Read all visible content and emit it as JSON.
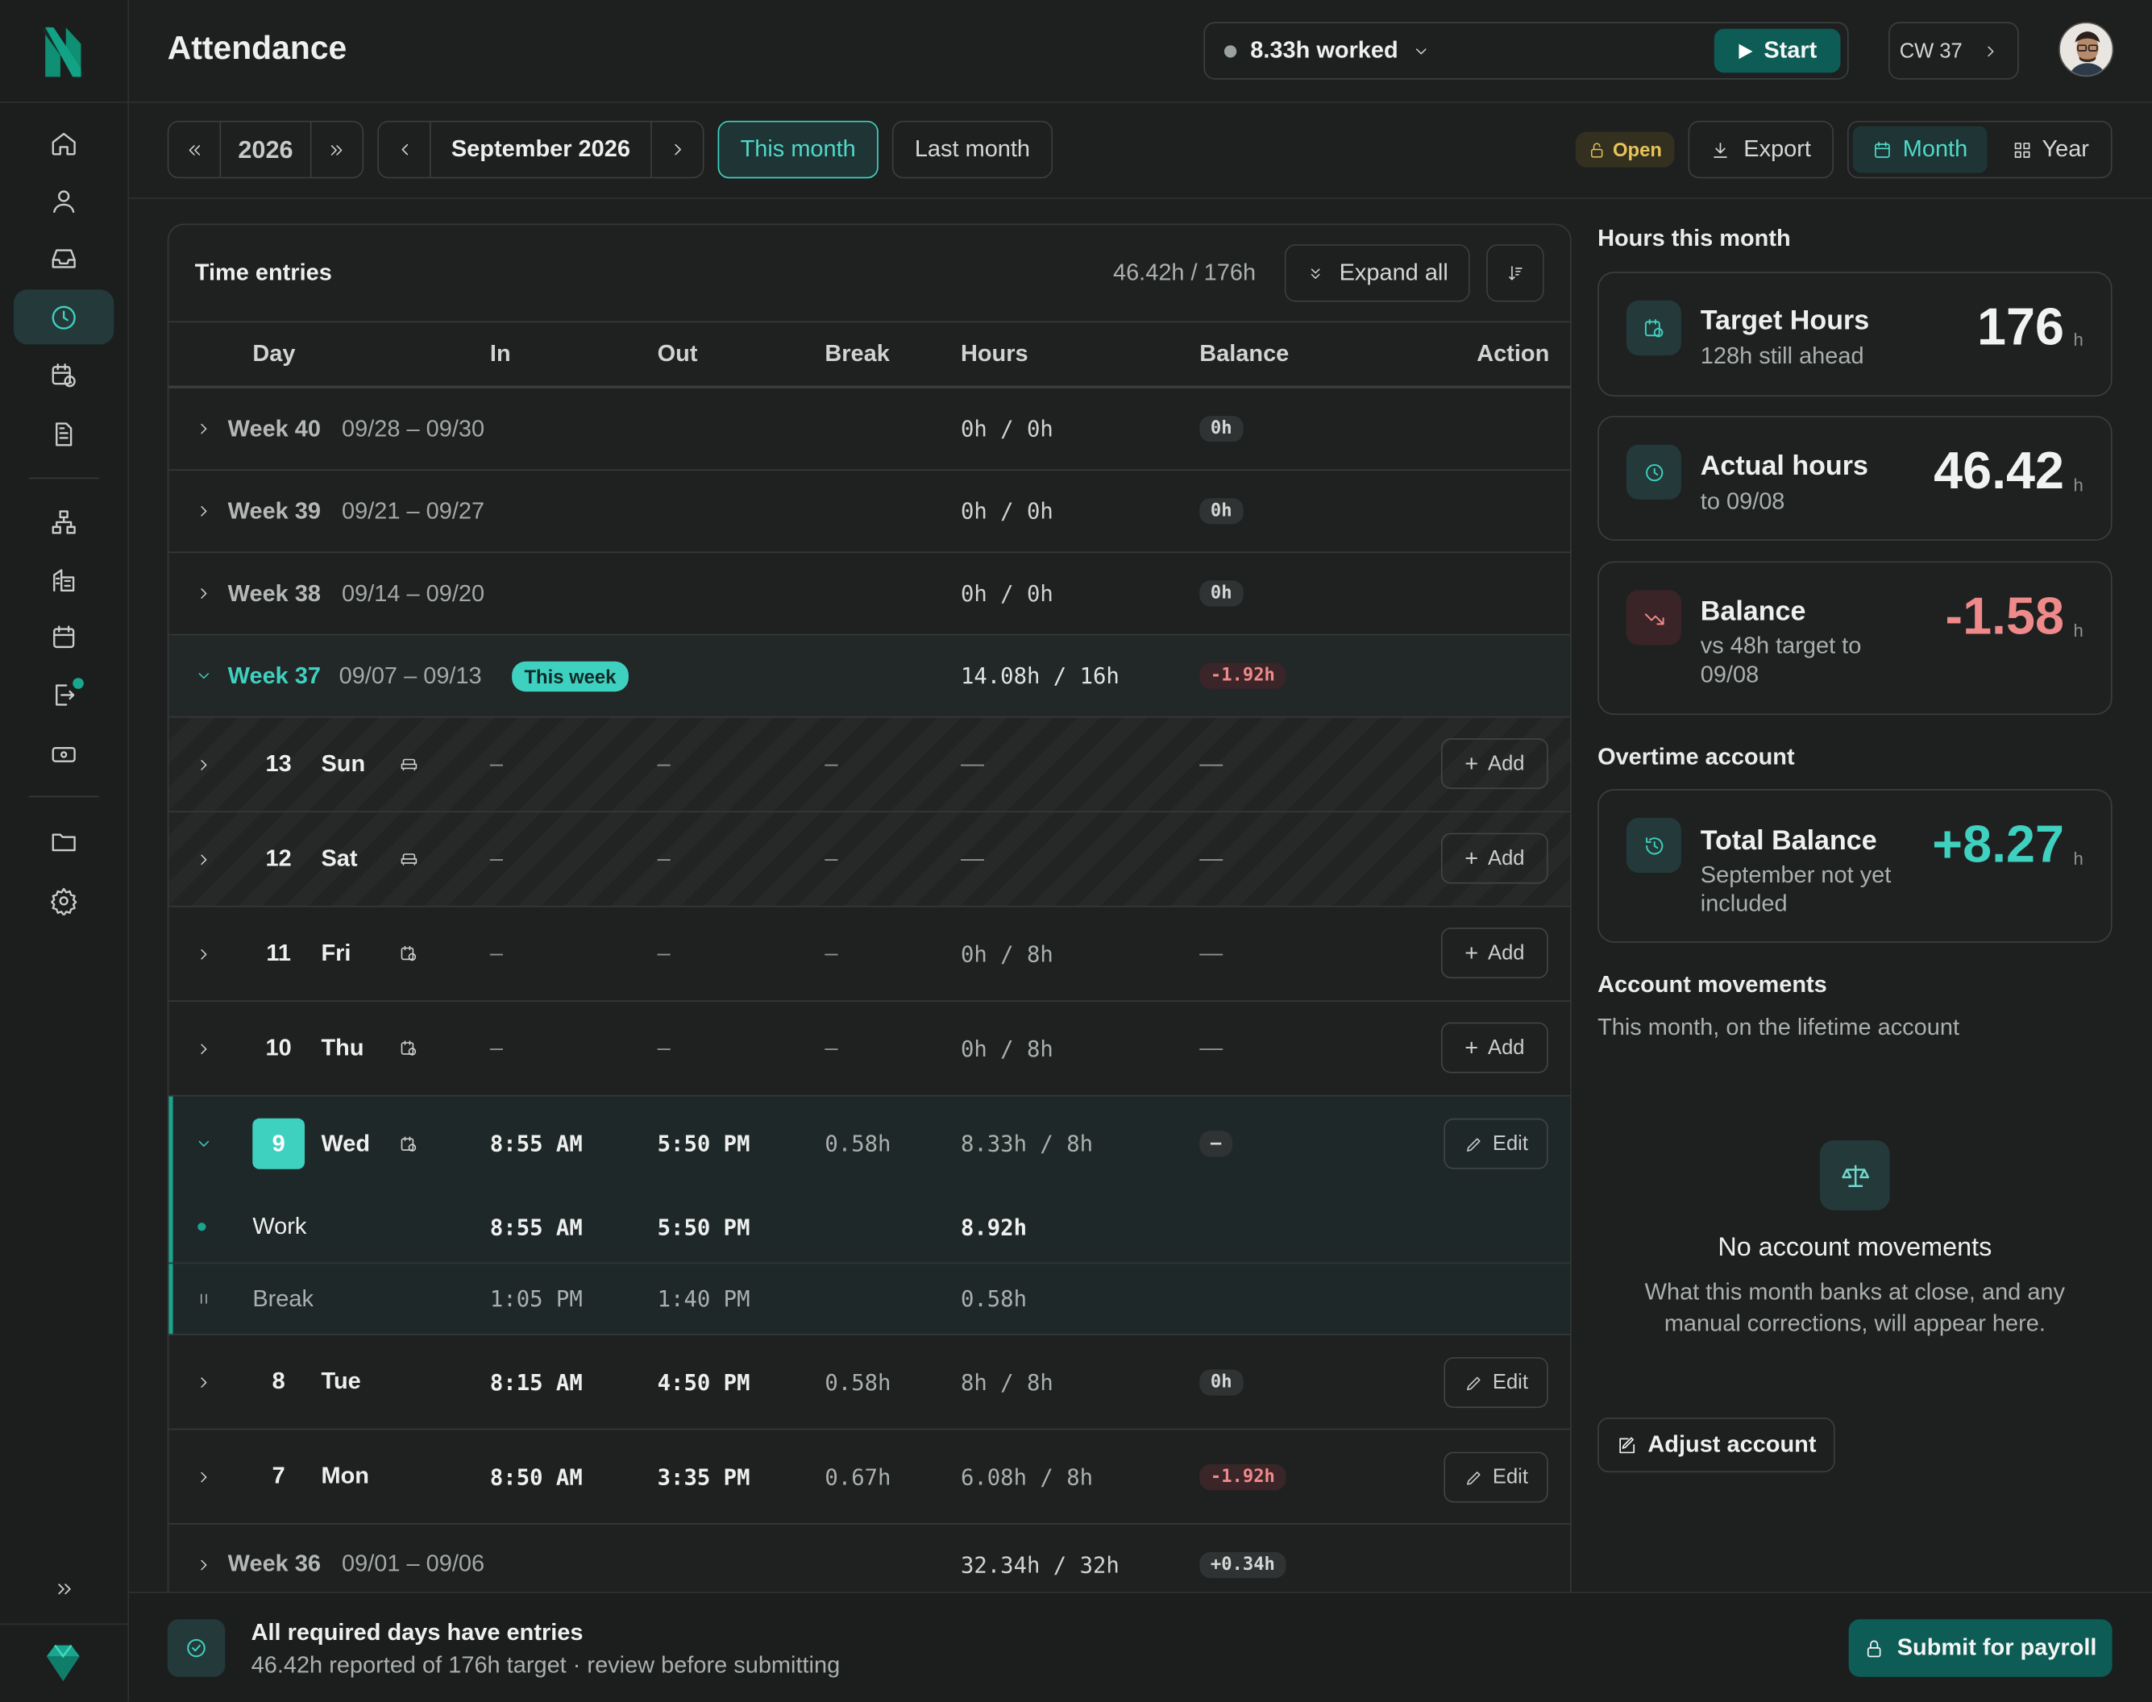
{
  "header": {
    "title": "Attendance",
    "worked": "8.33h worked",
    "start": "Start",
    "cw": "CW 37"
  },
  "toolbar": {
    "year": "2026",
    "month": "September 2026",
    "this_month": "This month",
    "last_month": "Last month",
    "status": "Open",
    "export": "Export",
    "view_month": "Month",
    "view_year": "Year"
  },
  "table": {
    "title": "Time entries",
    "total": "46.42h / 176h",
    "expand": "Expand all",
    "columns": [
      "Day",
      "In",
      "Out",
      "Break",
      "Hours",
      "Balance",
      "Action"
    ],
    "weeks": [
      {
        "label": "Week 40",
        "range": "09/28 – 09/30",
        "hours": "0h / 0h",
        "balance": "0h"
      },
      {
        "label": "Week 39",
        "range": "09/21 – 09/27",
        "hours": "0h / 0h",
        "balance": "0h"
      },
      {
        "label": "Week 38",
        "range": "09/14 – 09/20",
        "hours": "0h / 0h",
        "balance": "0h"
      },
      {
        "label": "Week 37",
        "range": "09/07 – 09/13",
        "tag": "This week",
        "hours": "14.08h / 16h",
        "balance": "-1.92h"
      },
      {
        "label": "Week 36",
        "range": "09/01 – 09/06",
        "hours": "32.34h / 32h",
        "balance": "+0.34h"
      }
    ],
    "days": [
      {
        "num": "13",
        "name": "Sun",
        "in": "–",
        "out": "–",
        "brk": "–",
        "hours": "—",
        "balance": "—",
        "action": "Add"
      },
      {
        "num": "12",
        "name": "Sat",
        "in": "–",
        "out": "–",
        "brk": "–",
        "hours": "—",
        "balance": "—",
        "action": "Add"
      },
      {
        "num": "11",
        "name": "Fri",
        "in": "–",
        "out": "–",
        "brk": "–",
        "hours": "0h / 8h",
        "balance": "—",
        "action": "Add"
      },
      {
        "num": "10",
        "name": "Thu",
        "in": "–",
        "out": "–",
        "brk": "–",
        "hours": "0h / 8h",
        "balance": "—",
        "action": "Add"
      },
      {
        "num": "9",
        "name": "Wed",
        "in": "8:55 AM",
        "out": "5:50 PM",
        "brk": "0.58h",
        "hours": "8.33h / 8h",
        "balance": "–",
        "action": "Edit"
      },
      {
        "num": "8",
        "name": "Tue",
        "in": "8:15 AM",
        "out": "4:50 PM",
        "brk": "0.58h",
        "hours": "8h / 8h",
        "balance": "0h",
        "action": "Edit"
      },
      {
        "num": "7",
        "name": "Mon",
        "in": "8:50 AM",
        "out": "3:35 PM",
        "brk": "0.67h",
        "hours": "6.08h / 8h",
        "balance": "-1.92h",
        "action": "Edit"
      }
    ],
    "segments": [
      {
        "label": "Work",
        "in": "8:55 AM",
        "out": "5:50 PM",
        "hours": "8.92h"
      },
      {
        "label": "Break",
        "in": "1:05 PM",
        "out": "1:40 PM",
        "hours": "0.58h"
      }
    ]
  },
  "summary": {
    "section": "Hours this month",
    "target": {
      "title": "Target Hours",
      "sub": "128h still ahead",
      "value": "176",
      "unit": "h"
    },
    "actual": {
      "title": "Actual hours",
      "sub": "to 09/08",
      "value": "46.42",
      "unit": "h"
    },
    "balance": {
      "title": "Balance",
      "sub": "vs 48h target to 09/08",
      "value": "-1.58",
      "unit": "h"
    }
  },
  "overtime": {
    "section": "Overtime account",
    "title": "Total Balance",
    "sub": "September not yet included",
    "value": "+8.27",
    "unit": "h"
  },
  "movements": {
    "section": "Account movements",
    "sub": "This month, on the lifetime account",
    "empty_title": "No account movements",
    "empty_text": "What this month banks at close, and any manual corrections, will appear here.",
    "adjust": "Adjust account"
  },
  "footer": {
    "title": "All required days have entries",
    "sub": "46.42h reported of 176h target · review before submitting",
    "submit": "Submit for payroll"
  },
  "colors": {
    "accent": "#3fd1c0",
    "danger": "#f08a8a",
    "brand": "#0e5a55"
  }
}
